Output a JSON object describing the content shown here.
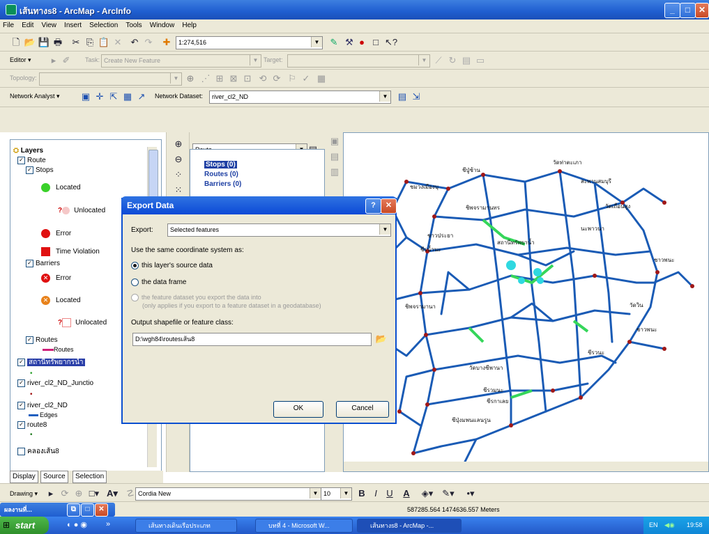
{
  "window": {
    "title": "เส้นทางs8 - ArcMap - ArcInfo",
    "min": "_",
    "max": "□",
    "close": "✕"
  },
  "menu": [
    "File",
    "Edit",
    "View",
    "Insert",
    "Selection",
    "Tools",
    "Window",
    "Help"
  ],
  "standard_toolbar": {
    "scale": "1:274,516"
  },
  "editor_toolbar": {
    "editor_label": "Editor ▾",
    "task_label": "Task:",
    "task_value": "Create New Feature",
    "target_label": "Target:",
    "target_value": ""
  },
  "topology_toolbar": {
    "label": "Topology:",
    "value": ""
  },
  "network_toolbar": {
    "label": "Network Analyst ▾",
    "dataset_label": "Network Dataset:",
    "dataset_value": "river_cl2_ND"
  },
  "toc": {
    "items": [
      {
        "label": "Layers"
      },
      {
        "label": "Route"
      },
      {
        "label": "Stops"
      },
      {
        "label": "Located"
      },
      {
        "label": "Unlocated"
      },
      {
        "label": "Error"
      },
      {
        "label": "Time Violation"
      },
      {
        "label": "Barriers"
      },
      {
        "label": "Error"
      },
      {
        "label": "Located"
      },
      {
        "label": "Unlocated"
      },
      {
        "label": "Routes"
      },
      {
        "label": "Routes"
      },
      {
        "label": "สถานีทรัพยากรน้ำ"
      },
      {
        "label": "river_cl2_ND_Junctio"
      },
      {
        "label": "river_cl2_ND"
      },
      {
        "label": "Edges"
      },
      {
        "label": "route8"
      },
      {
        "label": "คลองเส้น8"
      }
    ],
    "tabs": [
      "Display",
      "Source",
      "Selection"
    ]
  },
  "network_window": {
    "selector": "Route",
    "items": [
      "Stops (0)",
      "Routes (0)",
      "Barriers (0)"
    ]
  },
  "dialog": {
    "title": "Export Data",
    "export_label": "Export:",
    "export_value": "Selected features",
    "coord_label": "Use the same coordinate system as:",
    "opt1": "this layer's source data",
    "opt2": "the data frame",
    "opt3a": "the feature dataset you export the data into",
    "opt3b": "(only applies if you export to a feature dataset in a geodatabase)",
    "output_label": "Output shapefile or feature class:",
    "output_value": "D:\\wgh84\\routesเส้น8",
    "ok": "OK",
    "cancel": "Cancel",
    "help": "?",
    "close": "✕"
  },
  "map_labels": [
    "ชีปู่ช้าน",
    "ชมวงเมืองบุ",
    "วัดท่าตะเภา",
    "สะพานสมบุรี",
    "ชิพจรามานทร",
    "วัดเถื่อนสูง",
    "ชาวประยา",
    "นะพาวนา",
    "ชาวพนะ",
    "ชีรน้ำนะ",
    "สถานีทรัพยาน้ำ",
    "วัดวิน",
    "ชิพจรามานา",
    "ชาวพนะ",
    "ชีรวนะ",
    "ชีรวมนะ",
    "ชีรกาเลย",
    "วัดบางชีพานา",
    "ชีปุ่งมพนแลนรูน"
  ],
  "drawing_toolbar": {
    "drawing_label": "Drawing ▾",
    "font": "Cordia New",
    "size": "10",
    "bold": "B",
    "italic": "I",
    "underline": "U",
    "font_color": "A"
  },
  "status": {
    "coords": "587285.564 1474636.557 Meters"
  },
  "minimized": {
    "label": "ผลงานที่..."
  },
  "taskbar": {
    "start": "start",
    "tasks": [
      "เส้นทางเดินเรือประเภท",
      "บทที่ 4 - Microsoft W...",
      "เส้นทางs8 - ArcMap -..."
    ],
    "lang": "EN",
    "time": "19:58"
  }
}
